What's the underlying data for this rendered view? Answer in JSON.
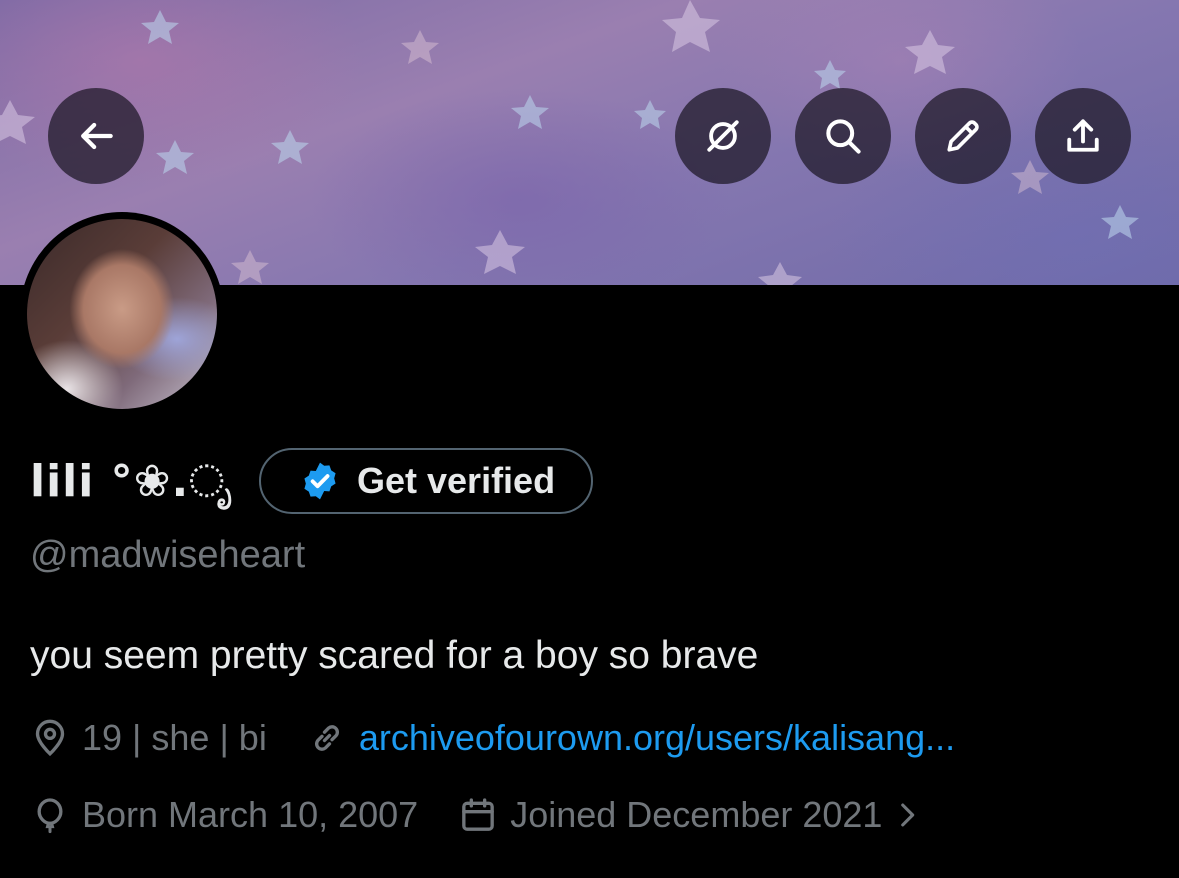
{
  "header": {
    "back_icon": "arrow-left-icon",
    "actions": [
      {
        "icon": "grok-icon"
      },
      {
        "icon": "search-icon"
      },
      {
        "icon": "edit-pencil-icon"
      },
      {
        "icon": "share-icon"
      }
    ]
  },
  "profile": {
    "display_name": "lili °❀.ೃ",
    "verify_button_label": "Get verified",
    "handle": "@madwiseheart",
    "bio": "you seem pretty scared for a boy so brave",
    "location": "19 | she | bi",
    "website": "archiveofourown.org/users/kalisang...",
    "birthday": "Born March 10, 2007",
    "joined": "Joined December 2021"
  },
  "colors": {
    "background": "#000000",
    "primary_text": "#e7e9ea",
    "secondary_text": "#71767b",
    "link": "#1d9bf0",
    "verified_badge": "#1d9bf0"
  }
}
